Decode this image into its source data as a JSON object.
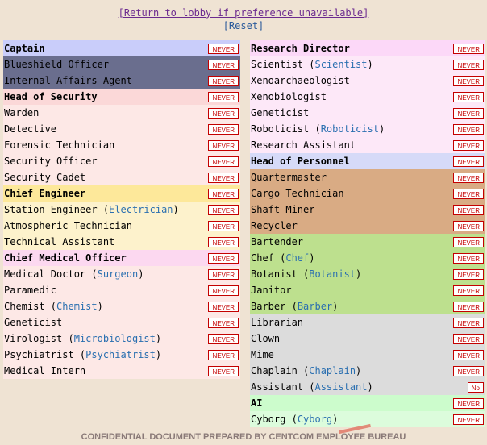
{
  "links": {
    "return_lobby": "[Return to lobby if preference unavailable]",
    "reset": "[Reset]"
  },
  "left_jobs": [
    {
      "name": "Captain",
      "alt": "",
      "head": true,
      "color": "#c9cdfa",
      "pref": "NEVER"
    },
    {
      "name": "Blueshield Officer",
      "alt": "",
      "head": false,
      "color": "#6a6e8e",
      "pref": "NEVER"
    },
    {
      "name": "Internal Affairs Agent",
      "alt": "",
      "head": false,
      "color": "#6a6e8e",
      "pref": "NEVER"
    },
    {
      "name": "Head of Security",
      "alt": "",
      "head": true,
      "color": "#fbd8d8",
      "pref": "NEVER"
    },
    {
      "name": "Warden",
      "alt": "",
      "head": false,
      "color": "#fde8e6",
      "pref": "NEVER"
    },
    {
      "name": "Detective",
      "alt": "",
      "head": false,
      "color": "#fde8e6",
      "pref": "NEVER"
    },
    {
      "name": "Forensic Technician",
      "alt": "",
      "head": false,
      "color": "#fde8e6",
      "pref": "NEVER"
    },
    {
      "name": "Security Officer",
      "alt": "",
      "head": false,
      "color": "#fde8e6",
      "pref": "NEVER"
    },
    {
      "name": "Security Cadet",
      "alt": "",
      "head": false,
      "color": "#fde8e6",
      "pref": "NEVER"
    },
    {
      "name": "Chief Engineer",
      "alt": "",
      "head": true,
      "color": "#fde89a",
      "pref": "NEVER"
    },
    {
      "name": "Station Engineer",
      "alt": "Electrician",
      "head": false,
      "color": "#fdf2cc",
      "pref": "NEVER"
    },
    {
      "name": "Atmospheric Technician",
      "alt": "",
      "head": false,
      "color": "#fdf2cc",
      "pref": "NEVER"
    },
    {
      "name": "Technical Assistant",
      "alt": "",
      "head": false,
      "color": "#fdf2cc",
      "pref": "NEVER"
    },
    {
      "name": "Chief Medical Officer",
      "alt": "",
      "head": true,
      "color": "#fcd8f0",
      "pref": "NEVER"
    },
    {
      "name": "Medical Doctor",
      "alt": "Surgeon",
      "head": false,
      "color": "#fde8e6",
      "pref": "NEVER"
    },
    {
      "name": "Paramedic",
      "alt": "",
      "head": false,
      "color": "#fde8e6",
      "pref": "NEVER"
    },
    {
      "name": "Chemist",
      "alt": "Chemist",
      "head": false,
      "color": "#fde8e6",
      "pref": "NEVER"
    },
    {
      "name": "Geneticist",
      "alt": "",
      "head": false,
      "color": "#fde8e6",
      "pref": "NEVER"
    },
    {
      "name": "Virologist",
      "alt": "Microbiologist",
      "head": false,
      "color": "#fde8e6",
      "pref": "NEVER"
    },
    {
      "name": "Psychiatrist",
      "alt": "Psychiatrist",
      "head": false,
      "color": "#fde8e6",
      "pref": "NEVER"
    },
    {
      "name": "Medical Intern",
      "alt": "",
      "head": false,
      "color": "#fde8e6",
      "pref": "NEVER"
    }
  ],
  "right_jobs": [
    {
      "name": "Research Director",
      "alt": "",
      "head": true,
      "color": "#fcd8f8",
      "pref": "NEVER"
    },
    {
      "name": "Scientist",
      "alt": "Scientist",
      "head": false,
      "color": "#fde8f8",
      "pref": "NEVER"
    },
    {
      "name": "Xenoarchaeologist",
      "alt": "",
      "head": false,
      "color": "#fde8f8",
      "pref": "NEVER"
    },
    {
      "name": "Xenobiologist",
      "alt": "",
      "head": false,
      "color": "#fde8f8",
      "pref": "NEVER"
    },
    {
      "name": "Geneticist",
      "alt": "",
      "head": false,
      "color": "#fde8f8",
      "pref": "NEVER"
    },
    {
      "name": "Roboticist",
      "alt": "Roboticist",
      "head": false,
      "color": "#fde8f8",
      "pref": "NEVER"
    },
    {
      "name": "Research Assistant",
      "alt": "",
      "head": false,
      "color": "#fde8f8",
      "pref": "NEVER"
    },
    {
      "name": "Head of Personnel",
      "alt": "",
      "head": true,
      "color": "#d6daf8",
      "pref": "NEVER"
    },
    {
      "name": "Quartermaster",
      "alt": "",
      "head": false,
      "color": "#d9ab84",
      "pref": "NEVER"
    },
    {
      "name": "Cargo Technician",
      "alt": "",
      "head": false,
      "color": "#d9ab84",
      "pref": "NEVER"
    },
    {
      "name": "Shaft Miner",
      "alt": "",
      "head": false,
      "color": "#d9ab84",
      "pref": "NEVER"
    },
    {
      "name": "Recycler",
      "alt": "",
      "head": false,
      "color": "#d9ab84",
      "pref": "NEVER"
    },
    {
      "name": "Bartender",
      "alt": "",
      "head": false,
      "color": "#bde08e",
      "pref": "NEVER"
    },
    {
      "name": "Chef",
      "alt": "Chef",
      "head": false,
      "color": "#bde08e",
      "pref": "NEVER"
    },
    {
      "name": "Botanist",
      "alt": "Botanist",
      "head": false,
      "color": "#bde08e",
      "pref": "NEVER"
    },
    {
      "name": "Janitor",
      "alt": "",
      "head": false,
      "color": "#bde08e",
      "pref": "NEVER"
    },
    {
      "name": "Barber",
      "alt": "Barber",
      "head": false,
      "color": "#bde08e",
      "pref": "NEVER"
    },
    {
      "name": "Librarian",
      "alt": "",
      "head": false,
      "color": "#dcdcdc",
      "pref": "NEVER"
    },
    {
      "name": "Clown",
      "alt": "",
      "head": false,
      "color": "#dcdcdc",
      "pref": "NEVER"
    },
    {
      "name": "Mime",
      "alt": "",
      "head": false,
      "color": "#dcdcdc",
      "pref": "NEVER"
    },
    {
      "name": "Chaplain",
      "alt": "Chaplain",
      "head": false,
      "color": "#dcdcdc",
      "pref": "NEVER"
    },
    {
      "name": "Assistant",
      "alt": "Assistant",
      "head": false,
      "color": "#dcdcdc",
      "pref": "No"
    },
    {
      "name": "AI",
      "alt": "",
      "head": true,
      "color": "#ccfccc",
      "pref": "NEVER"
    },
    {
      "name": "Cyborg",
      "alt": "Cyborg",
      "head": false,
      "color": "#dcfcdc",
      "pref": "NEVER"
    }
  ],
  "footer": "CONFIDENTIAL DOCUMENT PREPARED BY CENTCOM EMPLOYEE BUREAU"
}
